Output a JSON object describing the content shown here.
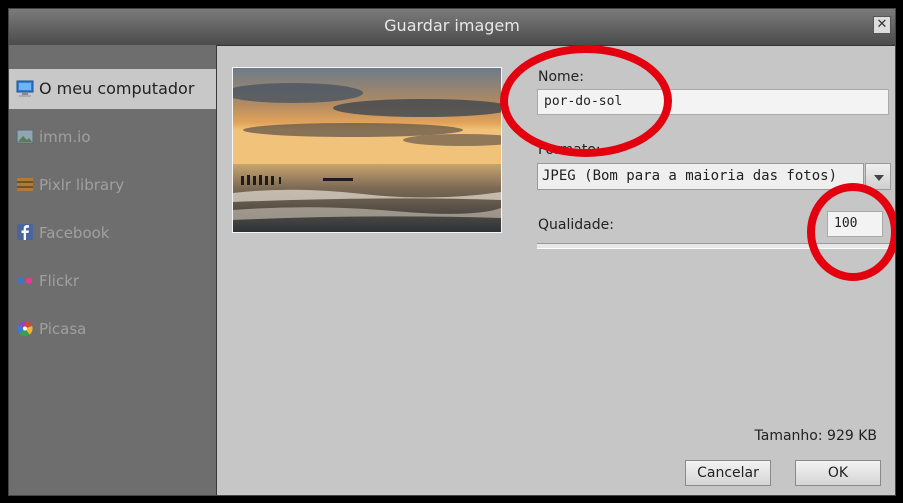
{
  "dialog": {
    "title": "Guardar imagem",
    "close_glyph": "✕"
  },
  "sidebar": {
    "items": [
      {
        "label": "O meu computador",
        "icon": "computer-icon",
        "active": true
      },
      {
        "label": "imm.io",
        "icon": "image-icon",
        "active": false
      },
      {
        "label": "Pixlr library",
        "icon": "library-icon",
        "active": false
      },
      {
        "label": "Facebook",
        "icon": "facebook-icon",
        "active": false
      },
      {
        "label": "Flickr",
        "icon": "flickr-icon",
        "active": false
      },
      {
        "label": "Picasa",
        "icon": "picasa-icon",
        "active": false
      }
    ]
  },
  "form": {
    "name_label": "Nome:",
    "name_value": "por-do-sol",
    "format_label": "Formato:",
    "format_value": "JPEG (Bom para a maioria das fotos)",
    "quality_label": "Qualidade:",
    "quality_value": "100"
  },
  "footer": {
    "size_text": "Tamanho: 929 KB",
    "cancel_label": "Cancelar",
    "ok_label": "OK"
  },
  "colors": {
    "annotation_red": "#e3000f",
    "sidebar_bg": "#6e6e6e",
    "panel_bg": "#c6c6c6"
  }
}
